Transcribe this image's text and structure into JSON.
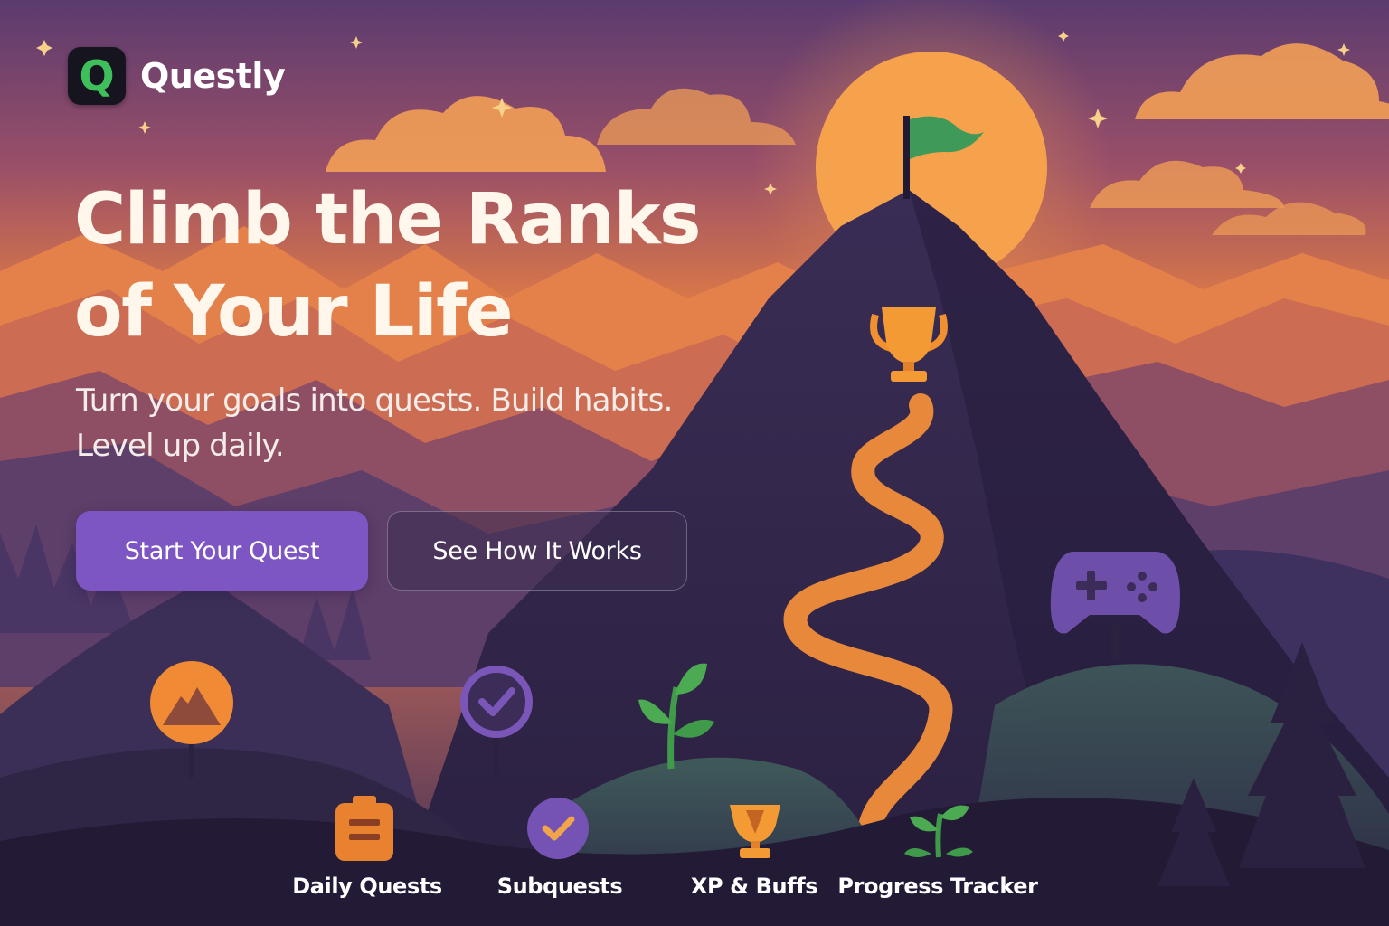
{
  "brand": {
    "name": "Questly",
    "logo_letter": "Q",
    "accent": "#3fbf5c"
  },
  "hero": {
    "headline_line1": "Climb the Ranks",
    "headline_line2": "of Your Life",
    "subhead_line1": "Turn your goals into quests. Build habits.",
    "subhead_line2": "Level up daily."
  },
  "cta": {
    "primary_label": "Start Your Quest",
    "secondary_label": "See How It Works",
    "primary_color": "#7d56c4"
  },
  "features": [
    {
      "label": "Daily Quests",
      "icon": "clipboard-icon"
    },
    {
      "label": "Subquests",
      "icon": "check-circle-icon"
    },
    {
      "label": "XP & Buffs",
      "icon": "trophy-icon"
    },
    {
      "label": "Progress Tracker",
      "icon": "sprout-icon"
    }
  ],
  "scene_icons": [
    "sun",
    "flag-icon",
    "trophy-icon",
    "mountain-badge-icon",
    "check-circle-icon",
    "sprout-icon",
    "gamepad-icon"
  ],
  "palette": {
    "sky_top": "#5a3a6e",
    "sky_glow": "#f08a3c",
    "mountain_dark": "#2e2445",
    "path": "#e8883a"
  }
}
